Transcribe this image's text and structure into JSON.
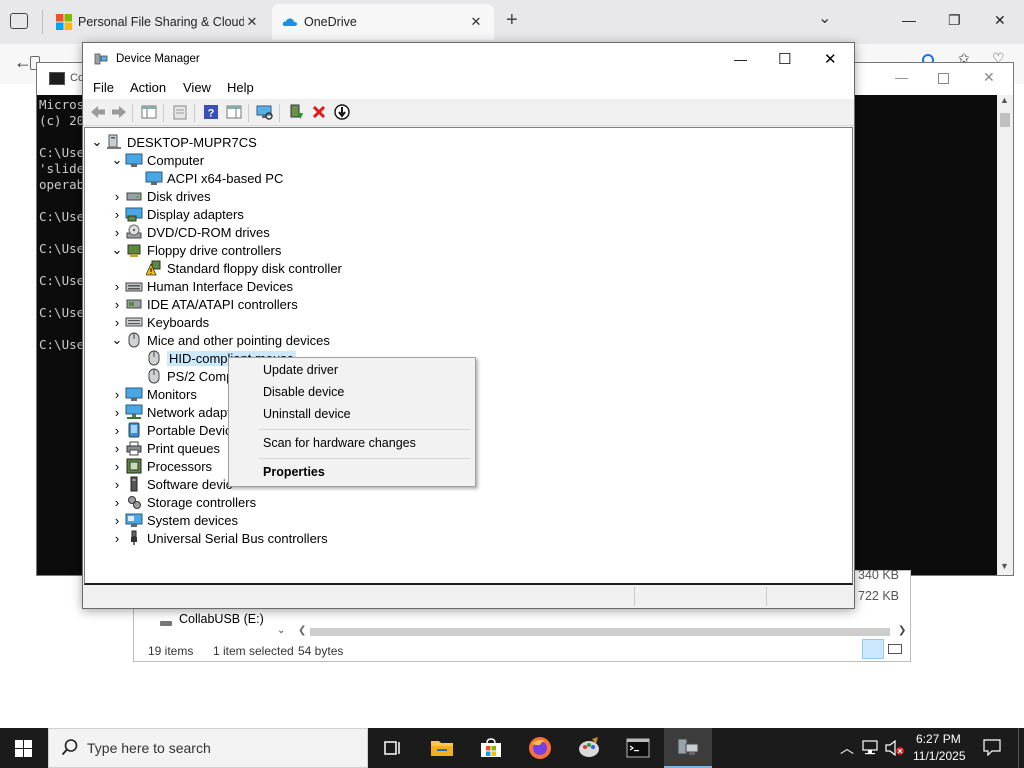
{
  "browser": {
    "tabs": [
      {
        "label": "Personal File Sharing & Cloud S",
        "close": "✕"
      },
      {
        "label": "OneDrive",
        "close": "✕"
      }
    ],
    "new_tab": "+",
    "tab_list": "⌄",
    "minimize": "—",
    "restore": "❐",
    "close": "✕"
  },
  "cmd": {
    "title": "Co",
    "lines": "Micros\n(c) 20\n\nC:\\Use\n'slide\noperab\n\nC:\\Use\n\nC:\\Use\n\nC:\\Use\n\nC:\\Use\n\nC:\\Use"
  },
  "explorer": {
    "size_1": "340 KB",
    "size_2": "722 KB",
    "drive_label": "CollabUSB (E:)",
    "item_count": "19 items",
    "selection": "1 item selected",
    "selection_size": "54 bytes"
  },
  "device_manager": {
    "title": "Device Manager",
    "window_buttons": {
      "minimize": "—",
      "maximize": "☐",
      "close": "✕"
    },
    "menus": [
      "File",
      "Action",
      "View",
      "Help"
    ],
    "tree": {
      "root": "DESKTOP-MUPR7CS",
      "computer": "Computer",
      "acpi": "ACPI x64-based PC",
      "disk_drives": "Disk drives",
      "display_adapters": "Display adapters",
      "dvd_drives": "DVD/CD-ROM drives",
      "floppy_controllers": "Floppy drive controllers",
      "floppy_standard": "Standard floppy disk controller",
      "hid": "Human Interface Devices",
      "ide": "IDE ATA/ATAPI controllers",
      "keyboards": "Keyboards",
      "mice": "Mice and other pointing devices",
      "hid_mouse": "HID-compliant mouse",
      "ps2_mouse": "PS/2 Comp",
      "monitors": "Monitors",
      "network": "Network adapt",
      "portable": "Portable Devic",
      "print_queues": "Print queues",
      "processors": "Processors",
      "software": "Software devic",
      "storage": "Storage controllers",
      "system": "System devices",
      "usb": "Universal Serial Bus controllers"
    }
  },
  "context_menu": {
    "update": "Update driver",
    "disable": "Disable device",
    "uninstall": "Uninstall device",
    "scan": "Scan for hardware changes",
    "properties": "Properties"
  },
  "taskbar": {
    "search_placeholder": "Type here to search",
    "time": "6:27 PM",
    "date": "11/1/2025"
  },
  "colors": {
    "selection": "#cce8ff",
    "taskbar": "#1b1b1b",
    "error_red": "#e01818"
  }
}
